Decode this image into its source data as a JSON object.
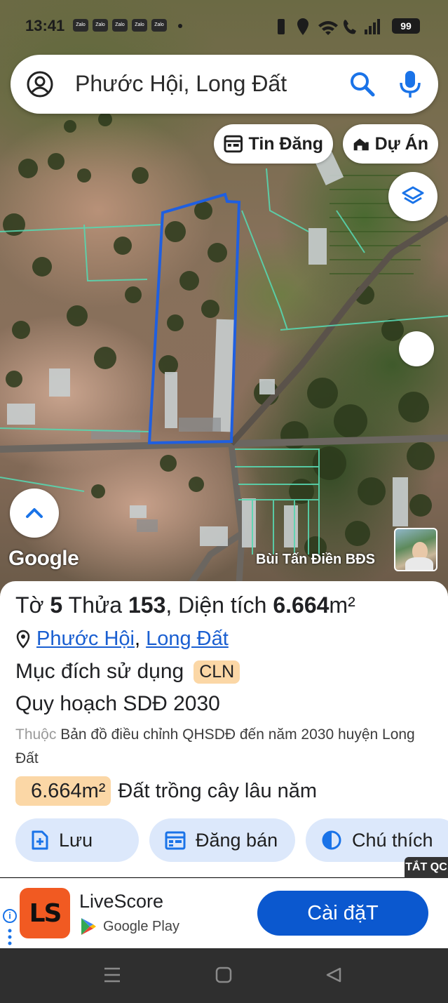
{
  "status_bar": {
    "time": "13:41",
    "notifications": [
      "Zalo",
      "Zalo",
      "Zalo",
      "Zalo",
      "Zalo"
    ],
    "battery": "99"
  },
  "search": {
    "query": "Phước Hội, Long Đất"
  },
  "map_chips": {
    "listings": "Tin Đăng",
    "projects": "Dự Án"
  },
  "map": {
    "google_label": "Google",
    "credit": "Bùi Tấn Điền BĐS"
  },
  "parcel": {
    "sheet_label": "Tờ",
    "sheet_no": "5",
    "plot_label": "Thửa",
    "plot_no": "153",
    "area_label": ", Diện tích",
    "area_value": "6.664",
    "area_unit": "m²",
    "ward": "Phước Hội",
    "district": "Long Đất",
    "separator": ",",
    "purpose_label": "Mục đích sử dụng",
    "purpose_code": "CLN",
    "plan_title": "Quy hoạch SDĐ 2030",
    "belong_prefix": "Thuộc",
    "belong_text": "Bản đồ điều chỉnh QHSDĐ đến năm 2030 huyện Long Đất",
    "zone_area": "6.664m²",
    "zone_desc": "Đất trồng cây lâu năm"
  },
  "actions": {
    "save": "Lưu",
    "post": "Đăng bán",
    "legend": "Chú thích"
  },
  "ad": {
    "close_label": "TẮT QC",
    "app_name": "LiveScore",
    "store": "Google Play",
    "install": "Cài đặT",
    "logo_text": "LS"
  },
  "colors": {
    "accent_blue": "#1a73e8",
    "parcel_outline": "#1f5fe0",
    "badge_orange": "#fbd7a6",
    "button_bg": "#dce8fb",
    "install_bg": "#0b58cf"
  }
}
